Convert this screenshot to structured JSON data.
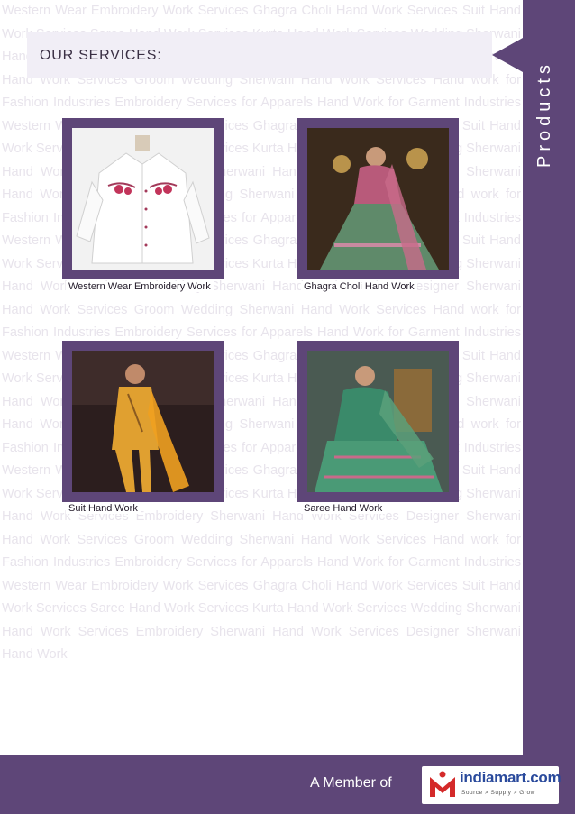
{
  "watermark_text": "Western Wear Embroidery Work Services Ghagra Choli Hand Work Services Suit Hand Work Services Saree Hand Work Services Kurta Hand Work Services Wedding Sherwani Hand Work Services Embroidery Sherwani Hand Work Services Designer Sherwani Hand Work Services Groom Wedding Sherwani Hand Work Services Hand work for Fashion Industries Embroidery Services for Apparels Hand Work for Garment Industries Western Wear Embroidery Work Services Ghagra Choli Hand Work Services Suit Hand Work Services Saree Hand Work Services Kurta Hand Work Services Wedding Sherwani Hand Work Services Embroidery Sherwani Hand Work Services Designer Sherwani Hand Work Services Groom Wedding Sherwani Hand Work Services Hand work for Fashion Industries Embroidery Services for Apparels Hand Work for Garment Industries Western Wear Embroidery Work Services Ghagra Choli Hand Work Services Suit Hand Work Services Saree Hand Work Services Kurta Hand Work Services Wedding Sherwani Hand Work Services Embroidery Sherwani Hand Work Services Designer Sherwani Hand Work Services Groom Wedding Sherwani Hand Work Services Hand work for Fashion Industries Embroidery Services for Apparels Hand Work for Garment Industries Western Wear Embroidery Work Services Ghagra Choli Hand Work Services Suit Hand Work Services Saree Hand Work Services Kurta Hand Work Services Wedding Sherwani Hand Work Services Embroidery Sherwani Hand Work Services Designer Sherwani Hand Work Services Groom Wedding Sherwani Hand Work Services Hand work for Fashion Industries Embroidery Services for Apparels Hand Work for Garment Industries Western Wear Embroidery Work Services Ghagra Choli Hand Work Services Suit Hand Work Services Saree Hand Work Services Kurta Hand Work Services Wedding Sherwani Hand Work Services Embroidery Sherwani Hand Work Services Designer Sherwani Hand Work Services Groom Wedding Sherwani Hand Work Services Hand work for Fashion Industries Embroidery Services for Apparels Hand Work for Garment Industries Western Wear Embroidery Work Services Ghagra Choli Hand Work Services Suit Hand Work Services Saree Hand Work Services Kurta Hand Work Services Wedding Sherwani Hand Work Services Embroidery Sherwani Hand Work Services Designer Sherwani Hand Work",
  "sidebar": {
    "label": "Products"
  },
  "header": {
    "title": "OUR SERVICES:"
  },
  "products": [
    {
      "caption": "Western Wear Embroidery Work",
      "icon": "shirt-photo"
    },
    {
      "caption": "Ghagra Choli Hand Work",
      "icon": "ghagra-photo"
    },
    {
      "caption": "Suit Hand Work",
      "icon": "suit-photo"
    },
    {
      "caption": "Saree Hand Work",
      "icon": "saree-photo"
    }
  ],
  "footer": {
    "member_text": "A Member of",
    "logo_text": "indiamart.com",
    "logo_tagline": "Source  >  Supply  >  Grow"
  },
  "colors": {
    "brand": "#5e4678",
    "watermark": "#e8e4ec",
    "logo_blue": "#2a4a9c",
    "logo_red": "#d42a2a"
  }
}
